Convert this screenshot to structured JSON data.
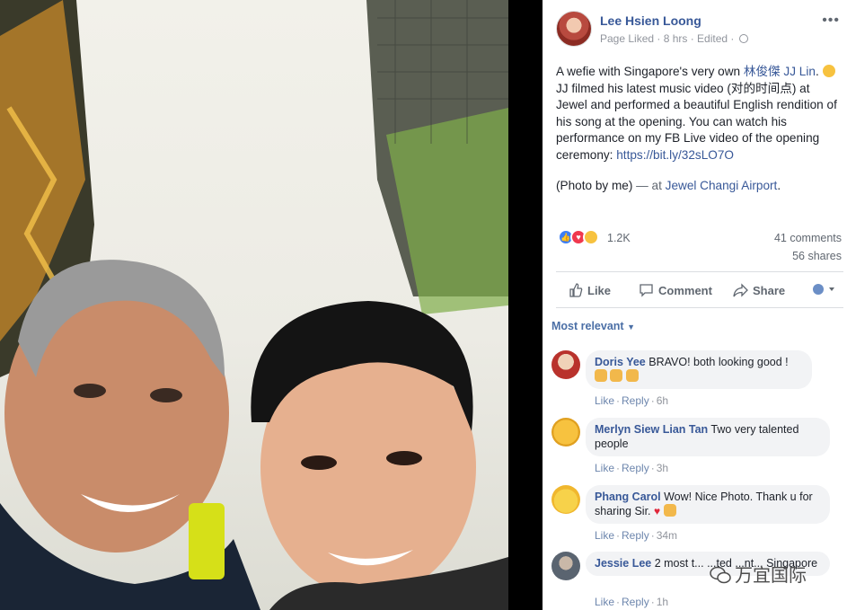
{
  "post": {
    "author": "Lee Hsien Loong",
    "meta": "Page Liked · 8 hrs · Edited ·",
    "text_1a": "A wefie with Singapore's very own ",
    "text_1_link": "林俊傑 JJ Lin",
    "text_1b": ".",
    "text_1c": "JJ filmed his latest music video (对的时间点) at Jewel and performed a beautiful English rendition of his song at the opening. You can watch his performance on my FB Live video of the opening ceremony: ",
    "text_url": "https://bit.ly/32sLO7O",
    "text_2a": "(Photo by me)",
    "text_2b": " — at ",
    "text_2_link": "Jewel Changi Airport",
    "text_2c": ".",
    "more_icon": "more-icon"
  },
  "stats": {
    "reactions": "1.2K",
    "comments": "41 comments",
    "shares": "56 shares"
  },
  "actions": {
    "like": "Like",
    "comment": "Comment",
    "share": "Share"
  },
  "sort": {
    "label": "Most relevant"
  },
  "comments": [
    {
      "name": "Doris Yee",
      "text": " BRAVO! both looking good !",
      "like": "Like",
      "reply": "Reply",
      "time": "6h"
    },
    {
      "name": "Merlyn Siew Lian Tan",
      "text": " Two very talented people",
      "like": "Like",
      "reply": "Reply",
      "time": "3h"
    },
    {
      "name": "Phang Carol",
      "text": " Wow! Nice Photo. Thank u for sharing Sir.",
      "like": "Like",
      "reply": "Reply",
      "time": "34m"
    },
    {
      "name": "Jessie Lee",
      "text": " 2 most t... ...ted ...nt... Singapore",
      "like": "Like",
      "reply": "Reply",
      "time": "1h"
    }
  ],
  "watermark": "万宜国际",
  "colors": {
    "link": "#385898",
    "muted": "#90949c",
    "bubble": "#f2f3f5"
  }
}
